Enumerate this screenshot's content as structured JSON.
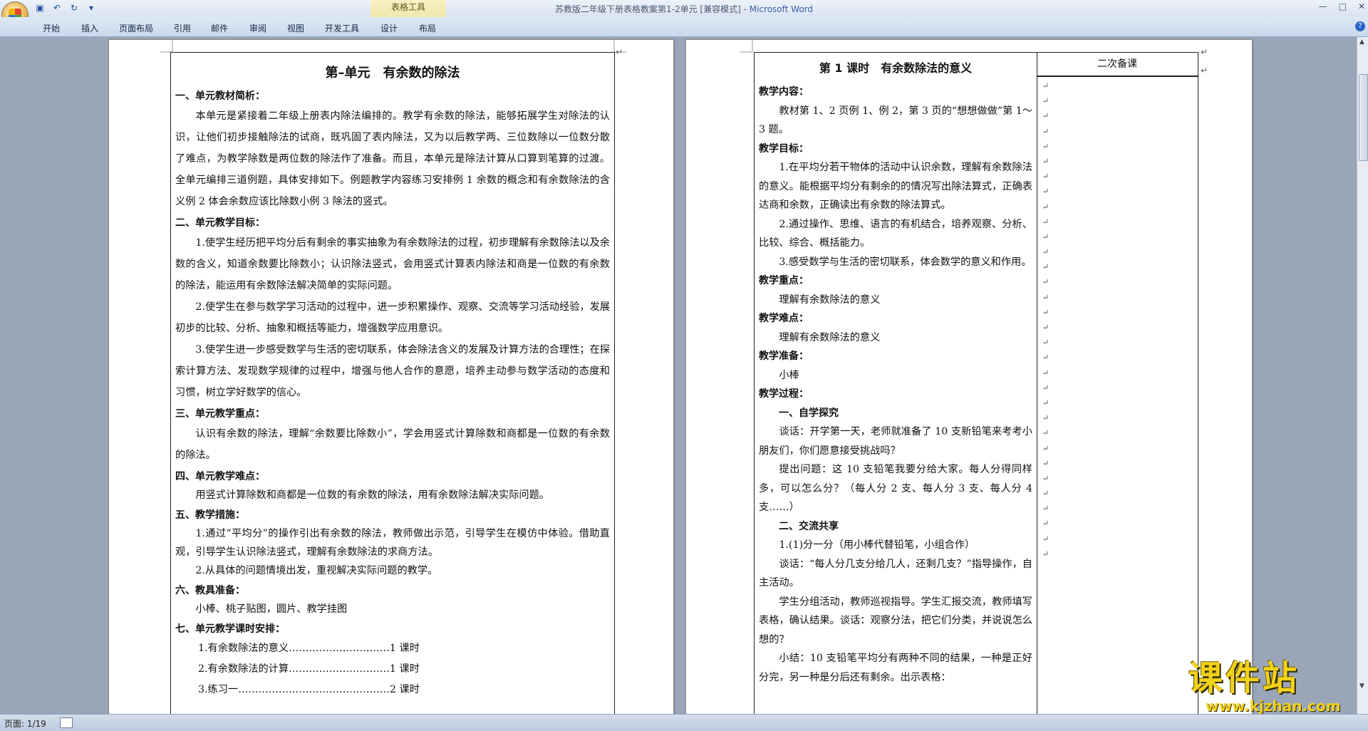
{
  "window": {
    "title_doc": "苏教版二年级下册表格教案第1-2单元 [兼容模式]",
    "title_sep": " - ",
    "title_app": "Microsoft Word",
    "context_tab": "表格工具"
  },
  "ribbon": {
    "tabs": [
      "开始",
      "插入",
      "页面布局",
      "引用",
      "邮件",
      "审阅",
      "视图",
      "开发工具",
      "设计",
      "布局"
    ]
  },
  "left_page": {
    "title": "第–单元　有余数的除法",
    "sections": [
      {
        "heading": "一、单元教材简析：",
        "paragraphs": [
          "本单元是紧接着二年级上册表内除法编排的。教学有余数的除法，能够拓展学生对除法的认识，让他们初步接触除法的试商，既巩固了表内除法，又为以后教学两、三位数除以一位数分散了难点，为教学除数是两位数的除法作了准备。而且，本单元是除法计算从口算到笔算的过渡。全单元编排三道例题，具体安排如下。例题教学内容练习安排例 1 余数的概念和有余数除法的含义例 2 体会余数应该比除数小例 3 除法的竖式。"
        ]
      },
      {
        "heading": "二、单元教学目标：",
        "paragraphs": [
          "1.使学生经历把平均分后有剩余的事实抽象为有余数除法的过程，初步理解有余数除法以及余数的含义，知道余数要比除数小；认识除法竖式，会用竖式计算表内除法和商是一位数的有余数的除法，能运用有余数除法解决简单的实际问题。",
          "2.使学生在参与数学学习活动的过程中，进一步积累操作、观察、交流等学习活动经验，发展初步的比较、分析、抽象和概括等能力，增强数学应用意识。",
          "3.使学生进一步感受数学与生活的密切联系，体会除法含义的发展及计算方法的合理性；在探索计算方法、发现数学规律的过程中，增强与他人合作的意愿，培养主动参与数学活动的态度和习惯，树立学好数学的信心。"
        ]
      },
      {
        "heading": "三、单元教学重点：",
        "paragraphs": [
          "认识有余数的除法，理解“余数要比除数小”，学会用竖式计算除数和商都是一位数的有余数的除法。"
        ]
      },
      {
        "heading": "四、单元教学难点：",
        "paragraphs": [
          "用竖式计算除数和商都是一位数的有余数的除法，用有余数除法解决实际问题。"
        ]
      },
      {
        "heading": "五、教学措施：",
        "paragraphs": [
          "1.通过“平均分”的操作引出有余数的除法，教师做出示范，引导学生在模仿中体验。借助直观，引导学生认识除法竖式，理解有余数除法的求商方法。",
          "2.从具体的问题情境出发，重视解决实际问题的教学。"
        ]
      },
      {
        "heading": "六、教具准备：",
        "paragraphs": [
          "小棒、桃子贴图，圆片、教学挂图"
        ]
      },
      {
        "heading": "七、单元教学课时安排：",
        "paragraphs": []
      }
    ],
    "schedule": [
      "1.有余数除法的意义…………………………1 课时",
      "2.有余数除法的计算…………………………1 课时",
      "3.练习一………………………………………2 课时"
    ]
  },
  "right_page": {
    "title": "第 1 课时　有余数除法的意义",
    "side_header": "二次备课",
    "blocks": [
      {
        "type": "head",
        "text": "教学内容："
      },
      {
        "type": "ind",
        "text": "教材第 1、2 页例 1、例 2，第 3 页的“想想做做”第 1～3 题。"
      },
      {
        "type": "head",
        "text": "教学目标："
      },
      {
        "type": "ind",
        "text": "1.在平均分若干物体的活动中认识余数，理解有余数除法的意义。能根据平均分有剩余的的情况写出除法算式，正确表达商和余数，正确读出有余数的除法算式。"
      },
      {
        "type": "ind",
        "text": "2.通过操作、思维、语言的有机结合，培养观察、分析、比较、综合、概括能力。"
      },
      {
        "type": "ind",
        "text": "3.感受数学与生活的密切联系，体会数学的意义和作用。"
      },
      {
        "type": "head",
        "text": "教学重点："
      },
      {
        "type": "ind",
        "text": "理解有余数除法的意义"
      },
      {
        "type": "head",
        "text": "教学难点："
      },
      {
        "type": "ind",
        "text": "理解有余数除法的意义"
      },
      {
        "type": "head",
        "text": "教学准备："
      },
      {
        "type": "ind",
        "text": "小棒"
      },
      {
        "type": "head",
        "text": "教学过程："
      },
      {
        "type": "indhead",
        "text": "一、自学探究"
      },
      {
        "type": "ind",
        "text": "谈话：开学第一天，老师就准备了 10 支新铅笔来考考小朋友们，你们愿意接受挑战吗？"
      },
      {
        "type": "ind",
        "text": "提出问题：这 10 支铅笔我要分给大家。每人分得同样多，可以怎么分？（每人分 2 支、每人分 3 支、每人分 4 支……）"
      },
      {
        "type": "indhead",
        "text": "二、交流共享"
      },
      {
        "type": "ind",
        "text": "1.(1)分一分（用小棒代替铅笔，小组合作）"
      },
      {
        "type": "ind",
        "text": "谈话：“每人分几支分给几人，还剩几支？”指导操作，自主活动。"
      },
      {
        "type": "ind",
        "text": "学生分组活动，教师巡视指导。学生汇报交流，教师填写表格，确认结果。谈话：观察分法，把它们分类，并说说怎么想的？"
      },
      {
        "type": "ind",
        "text": "小结：10 支铅笔平均分有两种不同的结果，一种是正好分完，另一种是分后还有剩余。出示表格："
      }
    ]
  },
  "status": {
    "page": "页面: 1/19"
  },
  "watermark": {
    "text": "课件站",
    "url": "www.kjzhan.com"
  }
}
